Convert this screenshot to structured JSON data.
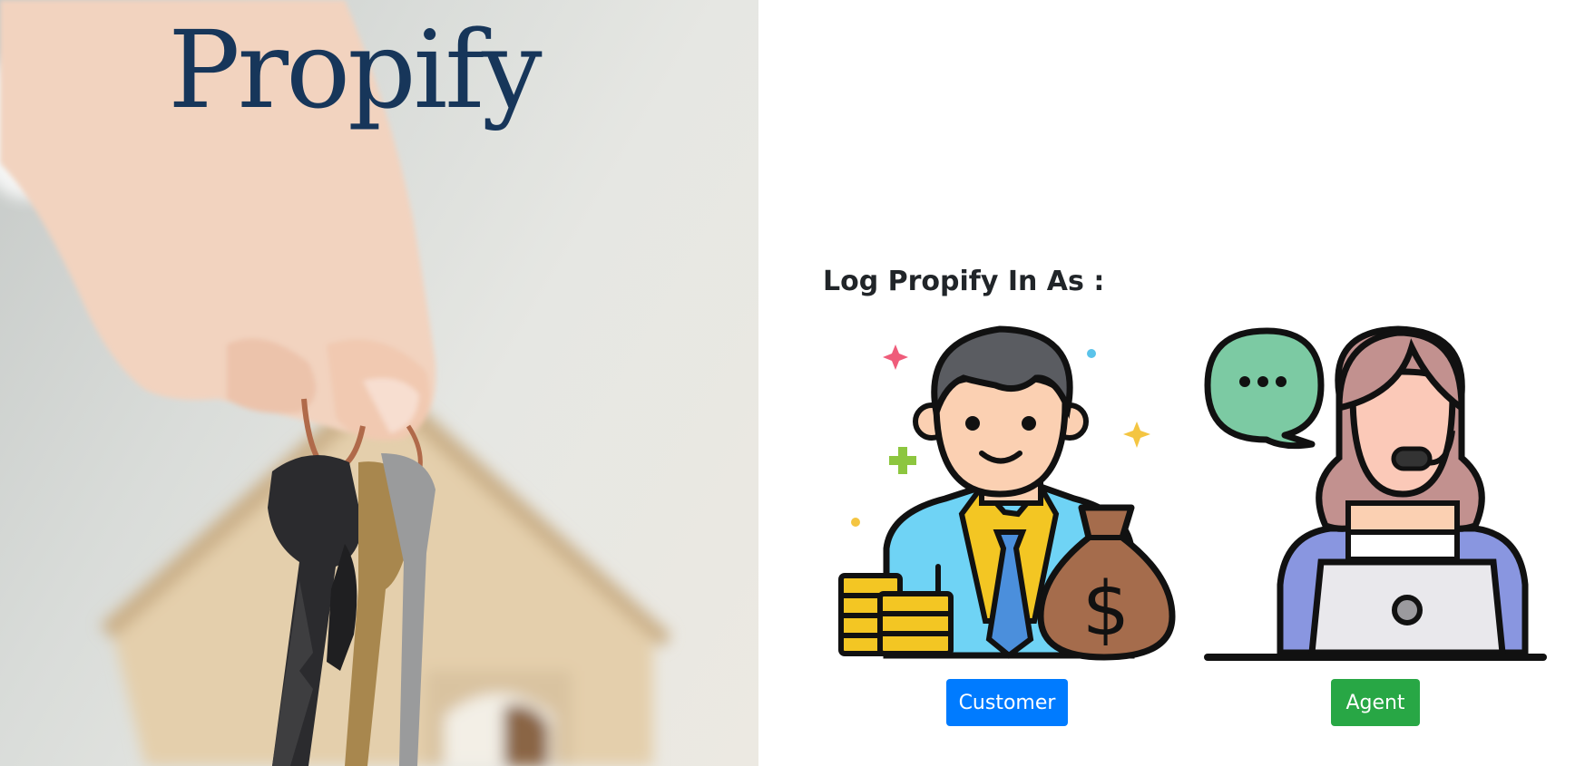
{
  "hero": {
    "brand_name": "Propify",
    "photo_icon": "hand-holding-keys-photo"
  },
  "login": {
    "heading": "Log Propify In As :",
    "options": [
      {
        "label": "Customer",
        "illustration": "businessman-moneybag-icon",
        "color": "#007bff"
      },
      {
        "label": "Agent",
        "illustration": "support-agent-headset-icon",
        "color": "#28a745"
      }
    ]
  }
}
